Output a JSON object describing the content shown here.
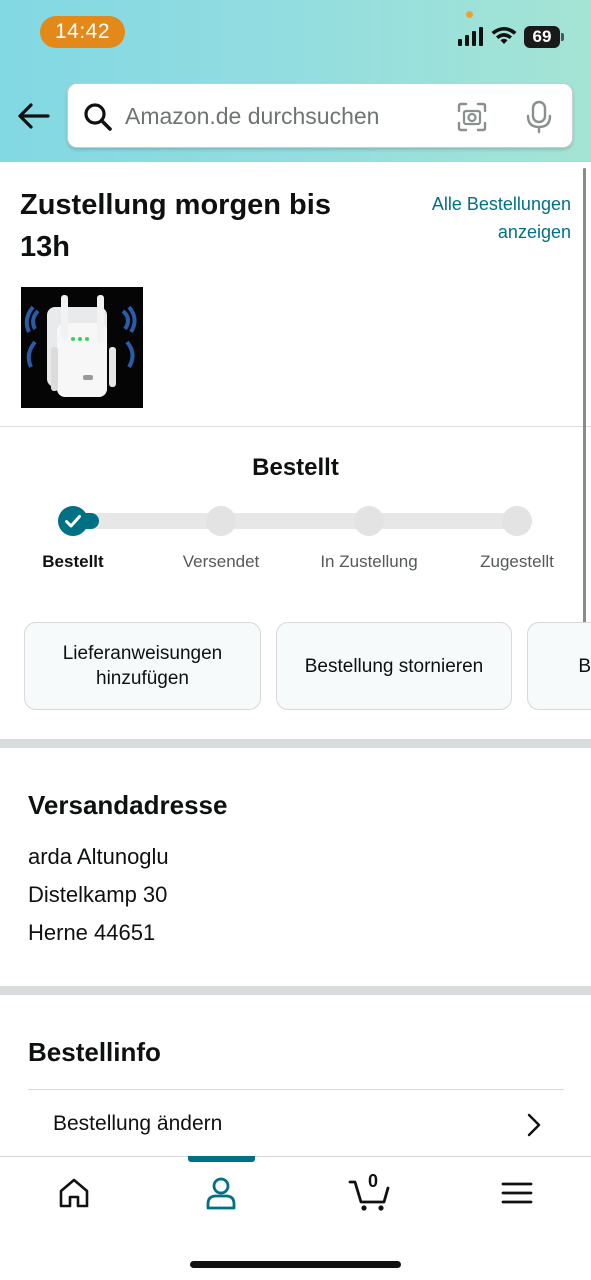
{
  "status_bar": {
    "time": "14:42",
    "battery": "69",
    "battery_level_percent": 69
  },
  "search": {
    "placeholder": "Amazon.de durchsuchen"
  },
  "delivery": {
    "title": "Zustellung morgen bis 13h",
    "all_orders_link": "Alle Bestellungen anzeigen"
  },
  "tracker": {
    "heading": "Bestellt",
    "steps": [
      "Bestellt",
      "Versendet",
      "In Zustellung",
      "Zugestellt"
    ],
    "current_step": 0
  },
  "actions": [
    {
      "label": "Lieferanweisungen hinzufügen"
    },
    {
      "label": "Bestellung stornieren"
    },
    {
      "label": "B"
    }
  ],
  "address": {
    "title": "Versandadresse",
    "name": "arda Altunoglu",
    "street": "Distelkamp 30",
    "city": "Herne 44651"
  },
  "order_info": {
    "title": "Bestellinfo",
    "change_order": "Bestellung ändern"
  },
  "bottom_nav": {
    "active": "account",
    "cart_count": "0"
  },
  "colors": {
    "accent": "#007185",
    "header_gradient_start": "#82d8e3",
    "header_gradient_end": "#a4e4d4",
    "time_pill": "#e3891a"
  }
}
